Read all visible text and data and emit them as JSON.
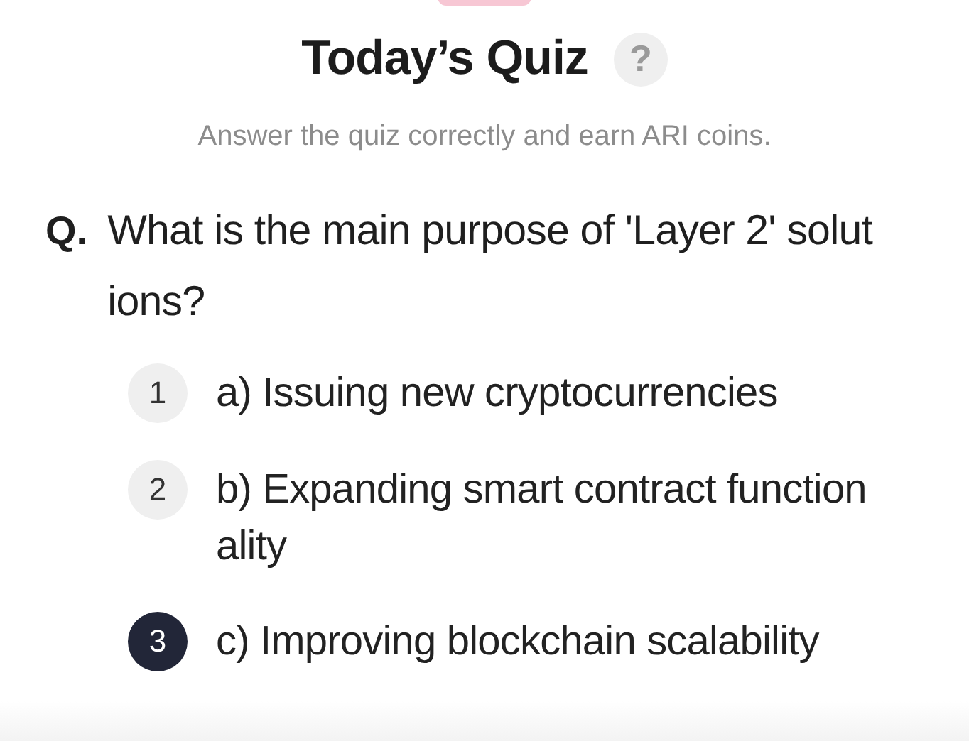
{
  "title": "Today’s Quiz",
  "help_icon": "?",
  "subtitle": "Answer the quiz correctly and earn ARI coins.",
  "question": {
    "prefix": "Q.",
    "text": "What is the main purpose of 'Layer 2' solutions?"
  },
  "options": [
    {
      "number": "1",
      "text": "a) Issuing new cryptocurrencies",
      "selected": false
    },
    {
      "number": "2",
      "text": "b) Expanding smart contract functionality",
      "selected": false
    },
    {
      "number": "3",
      "text": "c) Improving blockchain scalability",
      "selected": true
    }
  ]
}
